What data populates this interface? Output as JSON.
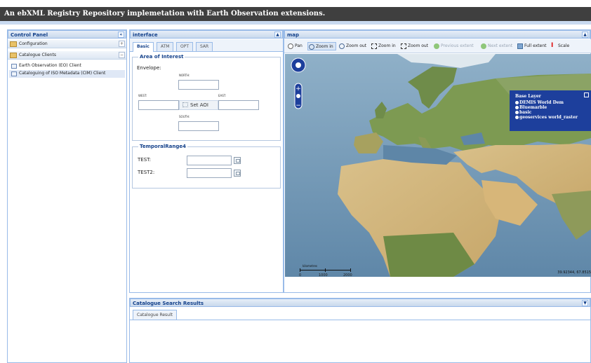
{
  "app": {
    "title": "An ebXML Registry Repository implemetation with Earth Observation extensions."
  },
  "control_panel": {
    "title": "Control Panel",
    "collapse_icon": "double-chevron-left-icon",
    "sections": [
      {
        "label": "Configuration",
        "toggle": "+"
      },
      {
        "label": "Catalogue Clients",
        "toggle": "−"
      }
    ],
    "items": [
      {
        "label": "Earth Observation (EO) Client"
      },
      {
        "label": "Cataloguing of ISO Metadata (CIM) Client"
      }
    ]
  },
  "interface": {
    "title": "interface",
    "tabs": [
      {
        "label": "Basic",
        "active": true
      },
      {
        "label": "ATM"
      },
      {
        "label": "OPT"
      },
      {
        "label": "SAR"
      }
    ],
    "aoi": {
      "legend": "Area of Interest",
      "envelope_label": "Envelope:",
      "north": "NORTH:",
      "west": "WEST:",
      "east": "EAST:",
      "south": "SOUTH:",
      "set_button": "Set AOI"
    },
    "temporal": {
      "legend": "TemporalRange4",
      "fields": [
        {
          "label": "TEST:"
        },
        {
          "label": "TEST2:"
        }
      ]
    }
  },
  "map": {
    "title": "map",
    "toolbar": [
      {
        "label": "Pan",
        "icon": "pan-icon"
      },
      {
        "label": "Zoom in",
        "icon": "zoom-in-icon",
        "pressed": true
      },
      {
        "label": "Zoom out",
        "icon": "zoom-out-icon"
      },
      {
        "label": "Zoom in",
        "icon": "zoom-in-box-icon"
      },
      {
        "label": "Zoom out",
        "icon": "zoom-out-box-icon"
      },
      {
        "label": "Previous extent",
        "icon": "previous-extent-icon",
        "disabled": true
      },
      {
        "label": "Next extent",
        "icon": "next-extent-icon",
        "disabled": true
      },
      {
        "label": "Full extent",
        "icon": "full-extent-icon"
      },
      {
        "label": "Scale",
        "icon": "scale-icon"
      }
    ],
    "base_layer": {
      "title": "Base Layer",
      "options": [
        "DEMIS World Dem",
        "Bluemarble",
        "basic",
        "geoservices world_raster"
      ]
    },
    "scale": {
      "unit": "kilometres",
      "ticks": [
        "0",
        "1000",
        "2000"
      ]
    },
    "coords": "39.92344, 67.8515"
  },
  "results": {
    "title": "Catalogue Search Results",
    "tab": "Catalogue Result"
  },
  "colors": {
    "header_text": "#15428b",
    "panel_border": "#99bbe8",
    "title_bg": "#3f3f3f",
    "baselayer_bg": "#1d3f9c"
  }
}
